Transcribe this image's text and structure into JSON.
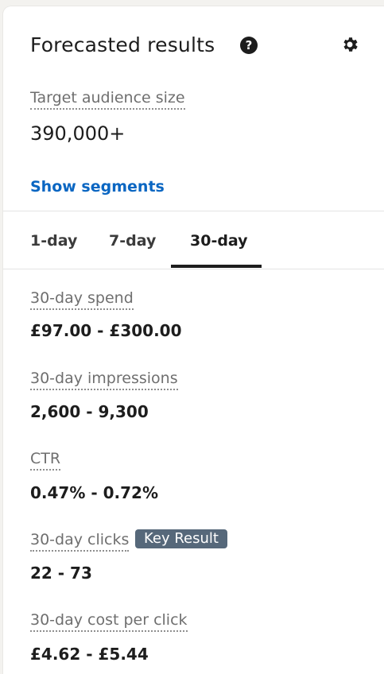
{
  "header": {
    "title": "Forecasted results",
    "help_icon": "question-circle-icon",
    "settings_icon": "gear-icon"
  },
  "audience": {
    "label": "Target audience size",
    "value": "390,000+",
    "show_segments": "Show segments"
  },
  "tabs": [
    {
      "label": "1-day",
      "selected": false
    },
    {
      "label": "7-day",
      "selected": false
    },
    {
      "label": "30-day",
      "selected": true
    }
  ],
  "metrics": [
    {
      "label": "30-day spend",
      "value": "£97.00 - £300.00"
    },
    {
      "label": "30-day impressions",
      "value": "2,600 - 9,300"
    },
    {
      "label": "CTR",
      "value": "0.47% - 0.72%"
    },
    {
      "label": "30-day clicks",
      "value": "22 - 73",
      "badge": "Key Result"
    },
    {
      "label": "30-day cost per click",
      "value": "£4.62 - £5.44"
    }
  ],
  "colors": {
    "link": "#0a66c2",
    "badge_bg": "#56687a",
    "text": "#1d1d1d",
    "muted": "#6f6f6f"
  }
}
